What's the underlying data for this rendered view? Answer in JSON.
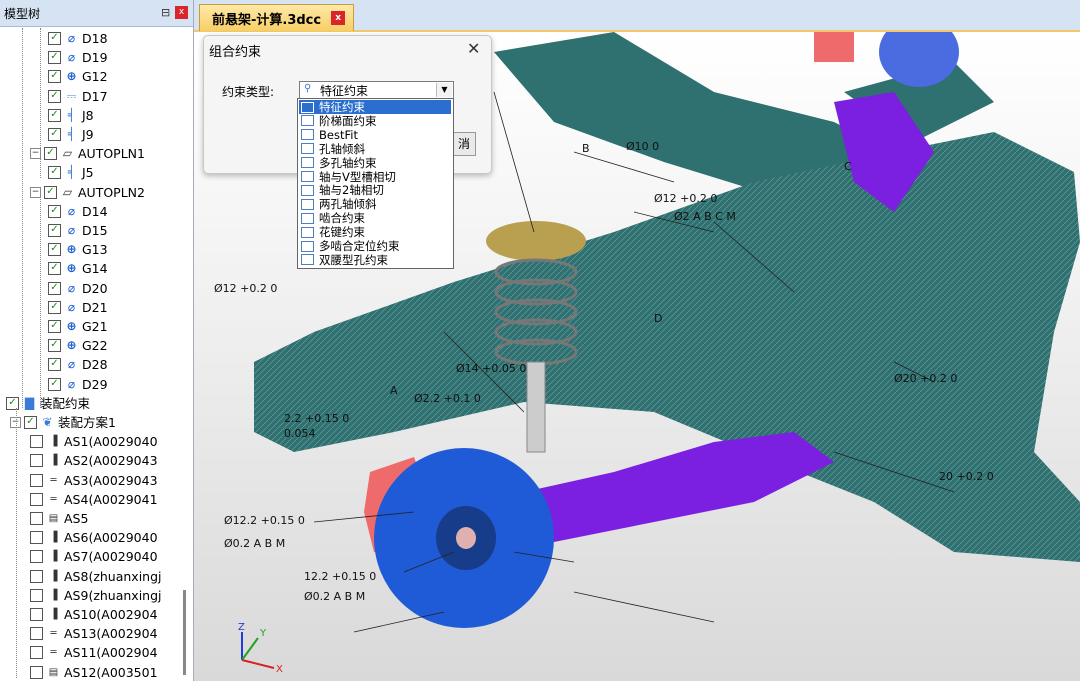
{
  "panel": {
    "title": "模型树",
    "pin_glyph": "⊟",
    "close_glyph": "x"
  },
  "tree": [
    {
      "label": "D18",
      "icon": "circle-slash",
      "level": 3
    },
    {
      "label": "D19",
      "icon": "circle-slash",
      "level": 3
    },
    {
      "label": "G12",
      "icon": "crosshair",
      "level": 3
    },
    {
      "label": "D17",
      "icon": "ruler",
      "level": 3
    },
    {
      "label": "J8",
      "icon": "datum-j",
      "level": 3
    },
    {
      "label": "J9",
      "icon": "datum-j",
      "level": 3
    },
    {
      "label": "AUTOPLN1",
      "icon": "plane",
      "level": 2,
      "expander": "−"
    },
    {
      "label": "J5",
      "icon": "datum-j",
      "level": 3
    },
    {
      "label": "AUTOPLN2",
      "icon": "plane",
      "level": 2,
      "expander": "−"
    },
    {
      "label": "D14",
      "icon": "circle-slash",
      "level": 3
    },
    {
      "label": "D15",
      "icon": "circle-slash",
      "level": 3
    },
    {
      "label": "G13",
      "icon": "crosshair",
      "level": 3
    },
    {
      "label": "G14",
      "icon": "crosshair",
      "level": 3
    },
    {
      "label": "D20",
      "icon": "circle-slash",
      "level": 3
    },
    {
      "label": "D21",
      "icon": "circle-slash",
      "level": 3
    },
    {
      "label": "G21",
      "icon": "crosshair",
      "level": 3
    },
    {
      "label": "G22",
      "icon": "crosshair",
      "level": 3
    },
    {
      "label": "D28",
      "icon": "circle-slash",
      "level": 3
    },
    {
      "label": "D29",
      "icon": "circle-slash",
      "level": 3
    },
    {
      "label": "装配约束",
      "icon": "assembly",
      "level": 0
    },
    {
      "label": "装配方案1",
      "icon": "assembly-plan",
      "level": 1,
      "expander": "−"
    },
    {
      "label": "AS1(A0029040",
      "icon": "as-pin",
      "level": 2,
      "unchecked": true
    },
    {
      "label": "AS2(A0029043",
      "icon": "as-pin",
      "level": 2,
      "unchecked": true
    },
    {
      "label": "AS3(A0029043",
      "icon": "as-bar",
      "level": 2,
      "unchecked": true
    },
    {
      "label": "AS4(A0029041",
      "icon": "as-bar",
      "level": 2,
      "unchecked": true
    },
    {
      "label": "AS5",
      "icon": "as-block",
      "level": 2,
      "unchecked": true
    },
    {
      "label": "AS6(A0029040",
      "icon": "as-pin",
      "level": 2,
      "unchecked": true
    },
    {
      "label": "AS7(A0029040",
      "icon": "as-pin",
      "level": 2,
      "unchecked": true
    },
    {
      "label": "AS8(zhuanxingj",
      "icon": "as-pin",
      "level": 2,
      "unchecked": true
    },
    {
      "label": "AS9(zhuanxingj",
      "icon": "as-pin",
      "level": 2,
      "unchecked": true
    },
    {
      "label": "AS10(A002904",
      "icon": "as-pin",
      "level": 2,
      "unchecked": true
    },
    {
      "label": "AS13(A002904",
      "icon": "as-bar",
      "level": 2,
      "unchecked": true
    },
    {
      "label": "AS11(A002904",
      "icon": "as-bar",
      "level": 2,
      "unchecked": true
    },
    {
      "label": "AS12(A003501",
      "icon": "as-block",
      "level": 2,
      "unchecked": true
    }
  ],
  "tab": {
    "title": "前悬架-计算.3dcc",
    "close_glyph": "x"
  },
  "dialog": {
    "title": "组合约束",
    "close_glyph": "✕",
    "type_label": "约束类型:",
    "selected": "特征约束",
    "button_fragment": "消"
  },
  "dropdown_options": [
    "特征约束",
    "阶梯面约束",
    "BestFit",
    "孔轴倾斜",
    "多孔轴约束",
    "轴与V型槽相切",
    "轴与2轴相切",
    "两孔轴倾斜",
    "啮合约束",
    "花键约束",
    "多啮合定位约束",
    "双腰型孔约束"
  ],
  "viewport": {
    "annotations": [
      "Ø10 0",
      "Ø12 +0.2 0",
      "Ø2 A B C M",
      "Ø12 +0.2 0",
      "Ø14 +0.05 0",
      "20 +0.2 0",
      "Ø20 +0.2 0",
      "Ø12.2 +0.15 0",
      "Ø0.2 A B M",
      "12.2 +0.15 0",
      "Ø0.2 A B M",
      "2.2 +0.15 0",
      "0.054",
      "Ø2.2 +0.1 0",
      "A",
      "B",
      "C",
      "D"
    ],
    "axes": {
      "z": "Z",
      "y": "Y",
      "x": "X"
    }
  },
  "colors": {
    "frame": "#2f7070",
    "arm": "#7b1fe0",
    "caliper": "#ef6a6a",
    "disc": "#1f5bd6",
    "mount": "#b8a050",
    "tab_accent": "#f2c86b"
  }
}
